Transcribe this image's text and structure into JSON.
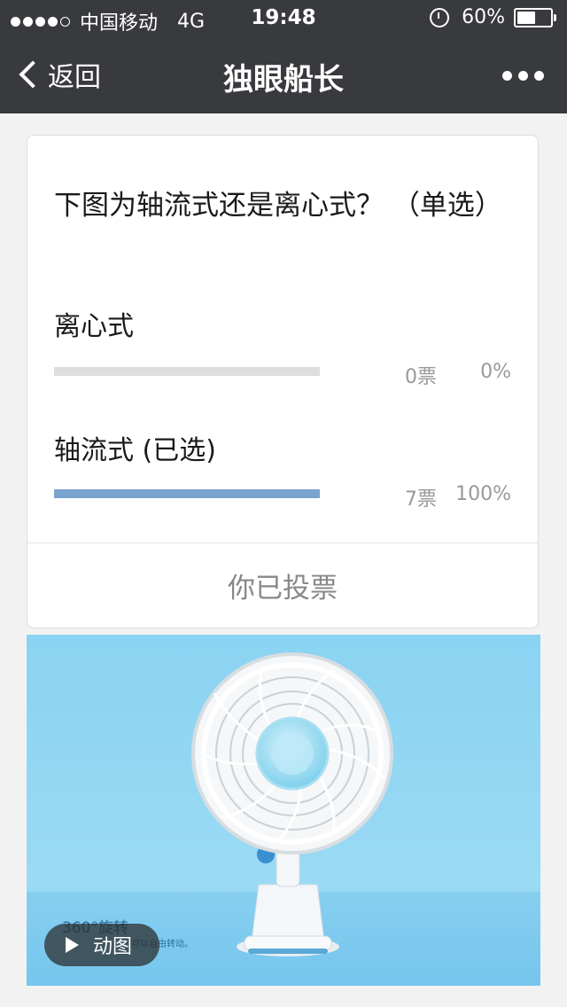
{
  "status_bar": {
    "carrier": "中国移动",
    "network": "4G",
    "time": "19:48",
    "battery": "60%",
    "battery_level": 0.6,
    "signal_strength": 4
  },
  "nav": {
    "back_label": "返回",
    "title": "独眼船长"
  },
  "poll": {
    "question": "下图为轴流式还是离心式？ （单选）",
    "options": [
      {
        "label": "离心式",
        "votes": "0票",
        "percent": "0%",
        "fill": 0
      },
      {
        "label": "轴流式 (已选)",
        "votes": "7票",
        "percent": "100%",
        "fill": 1.0
      }
    ],
    "status": "你已投票"
  },
  "image": {
    "overlay_title": "360°旋转",
    "overlay_caption": "可以自由转动。",
    "play_label": "动图"
  },
  "colors": {
    "bar_fill": "#7ba3cf",
    "bar_track": "#dedede",
    "header_bg": "#393a3e",
    "image_bg": "#8ed0f0"
  }
}
